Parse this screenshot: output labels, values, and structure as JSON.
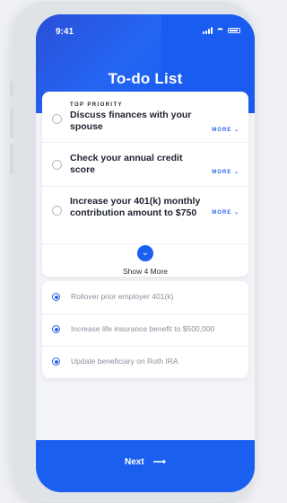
{
  "status": {
    "time": "9:41"
  },
  "header": {
    "title": "To-do List"
  },
  "tasks": [
    {
      "kicker": "TOP PRIORITY",
      "text": "Discuss finances with your spouse",
      "more": "MORE"
    },
    {
      "kicker": "",
      "text": "Check your annual credit score",
      "more": "MORE"
    },
    {
      "kicker": "",
      "text": "Increase your 401(k) monthly contribution amount to $750",
      "more": "MORE"
    }
  ],
  "show_more": {
    "label": "Show 4 More"
  },
  "completed": [
    {
      "label": "Rollover prior employer 401(k)"
    },
    {
      "label": "Increase life insurance benefit to $500,000"
    },
    {
      "label": "Update beneficiary on Roth IRA"
    }
  ],
  "footer": {
    "next_label": "Next",
    "next_arrow": "⟶"
  },
  "colors": {
    "accent": "#1a5ff0",
    "header": "#1a5cf0"
  }
}
